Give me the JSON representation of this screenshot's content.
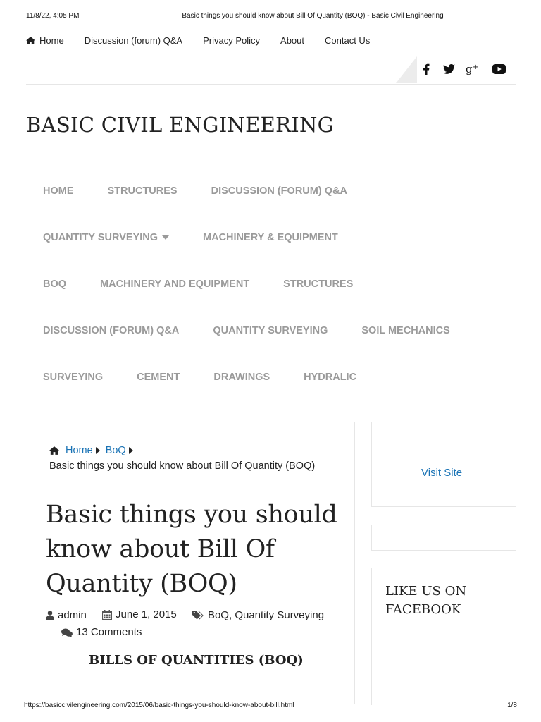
{
  "print_header": {
    "datetime": "11/8/22, 4:05 PM",
    "title": "Basic things you should know about Bill Of Quantity (BOQ) - Basic Civil Engineering"
  },
  "top_nav": {
    "items": [
      {
        "label": "Home",
        "icon": "home-icon"
      },
      {
        "label": "Discussion (forum) Q&A"
      },
      {
        "label": "Privacy Policy"
      },
      {
        "label": "About"
      },
      {
        "label": "Contact Us"
      }
    ]
  },
  "social": {
    "icons": [
      "facebook-icon",
      "twitter-icon",
      "google-plus-icon",
      "youtube-icon"
    ]
  },
  "site": {
    "title": "BASIC CIVIL ENGINEERING"
  },
  "main_menu": {
    "rows": [
      [
        "HOME",
        "STRUCTURES",
        "DISCUSSION (FORUM) Q&A"
      ],
      [
        "QUANTITY SURVEYING",
        "MACHINERY & EQUIPMENT"
      ],
      [
        "BOQ",
        "MACHINERY AND EQUIPMENT",
        "STRUCTURES"
      ],
      [
        "DISCUSSION (FORUM) Q&A",
        "QUANTITY SURVEYING",
        "SOIL MECHANICS"
      ],
      [
        "SURVEYING",
        "CEMENT",
        "DRAWINGS",
        "HYDRALIC"
      ]
    ]
  },
  "breadcrumb": {
    "home": "Home",
    "category": "BoQ",
    "current": "Basic things you should know about Bill Of Quantity (BOQ)"
  },
  "post": {
    "title": "Basic things you should know about Bill Of Quantity (BOQ)",
    "author": "admin",
    "date": "June 1, 2015",
    "category_1": "BoQ",
    "category_sep": ",",
    "category_2": "Quantity Surveying",
    "comments": "13 Comments",
    "section_heading": "BILLS OF QUANTITIES (BOQ)"
  },
  "sidebar": {
    "visit_site": "Visit Site",
    "like_heading": "LIKE US ON FACEBOOK"
  },
  "print_footer": {
    "url": "https://basiccivilengineering.com/2015/06/basic-things-you-should-know-about-bill.html",
    "page": "1/8"
  },
  "colors": {
    "link": "#1a73b5",
    "menu_text": "#9a9a9a",
    "text": "#222222"
  }
}
